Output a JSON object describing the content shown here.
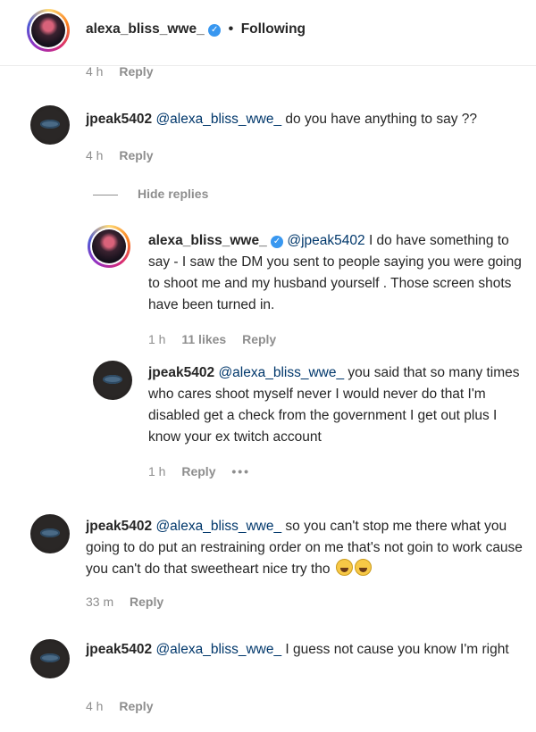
{
  "header": {
    "username": "alexa_bliss_wwe_",
    "separator": "•",
    "follow_status": "Following",
    "time": "4 h",
    "reply": "Reply"
  },
  "hide_replies": "Hide replies",
  "comments": [
    {
      "author": "jpeak5402",
      "mention": "@alexa_bliss_wwe_",
      "text": "do you have anything to say ??",
      "time": "4 h",
      "reply": "Reply"
    },
    {
      "author": "alexa_bliss_wwe_",
      "mention": "@jpeak5402",
      "text": "I do have something to say - I saw the DM you sent to people saying you were going to shoot me and my husband yourself . Those screen shots have been turned in.",
      "time": "1 h",
      "likes": "11 likes",
      "reply": "Reply"
    },
    {
      "author": "jpeak5402",
      "mention": "@alexa_bliss_wwe_",
      "text": "you said that so many times who cares shoot myself never I would never do that I'm disabled get a check from the government I get out plus I know your ex twitch account",
      "time": "1 h",
      "reply": "Reply",
      "more": "•••"
    },
    {
      "author": "jpeak5402",
      "mention": "@alexa_bliss_wwe_",
      "text": "so you can't stop me there what you going to do put an restraining order on me that's not goin to work cause you can't do that sweetheart nice try tho",
      "time": "33 m",
      "reply": "Reply"
    },
    {
      "author": "jpeak5402",
      "mention": "@alexa_bliss_wwe_",
      "text": "I guess not cause you know I'm right",
      "time": "4 h",
      "reply": "Reply"
    }
  ],
  "icons": {
    "verified": "verified-badge-icon",
    "emoji": "laughing-crying-emoji-icon"
  },
  "colors": {
    "mention": "#00376b",
    "verified": "#3897f0",
    "meta": "#8e8e8e"
  }
}
